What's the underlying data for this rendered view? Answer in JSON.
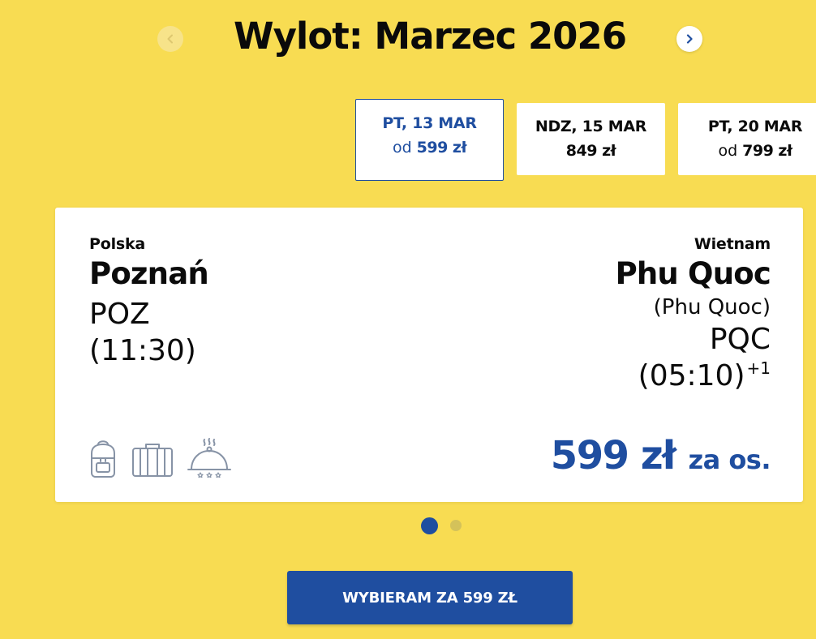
{
  "header": {
    "title": "Wylot: Marzec 2026",
    "prev_icon": "chevron-left-icon",
    "next_icon": "chevron-right-icon"
  },
  "dates": [
    {
      "label": "PT, 13 MAR",
      "prefix": "od",
      "price": "599 zł",
      "selected": true
    },
    {
      "label": "NDZ, 15 MAR",
      "prefix": "",
      "price": "849 zł",
      "selected": false
    },
    {
      "label": "PT, 20 MAR",
      "prefix": "od",
      "price": "799 zł",
      "selected": false
    }
  ],
  "flight": {
    "origin": {
      "country": "Polska",
      "city": "Poznań",
      "code": "POZ",
      "time": "(11:30)"
    },
    "destination": {
      "country": "Wietnam",
      "city": "Phu Quoc",
      "airport": "(Phu Quoc)",
      "code": "PQC",
      "time": "(05:10)",
      "day_offset": "+1"
    },
    "amenities": [
      "backpack-icon",
      "suitcase-icon",
      "meal-cloche-icon"
    ],
    "price": "599 zł",
    "per_person": "za os."
  },
  "pagination": {
    "count": 2,
    "active": 1
  },
  "cta": {
    "label": "WYBIERAM ZA 599 ZŁ"
  },
  "colors": {
    "background": "#f8dc52",
    "brand_blue": "#1f4ea0",
    "card": "#ffffff",
    "icon": "#8793a6"
  }
}
